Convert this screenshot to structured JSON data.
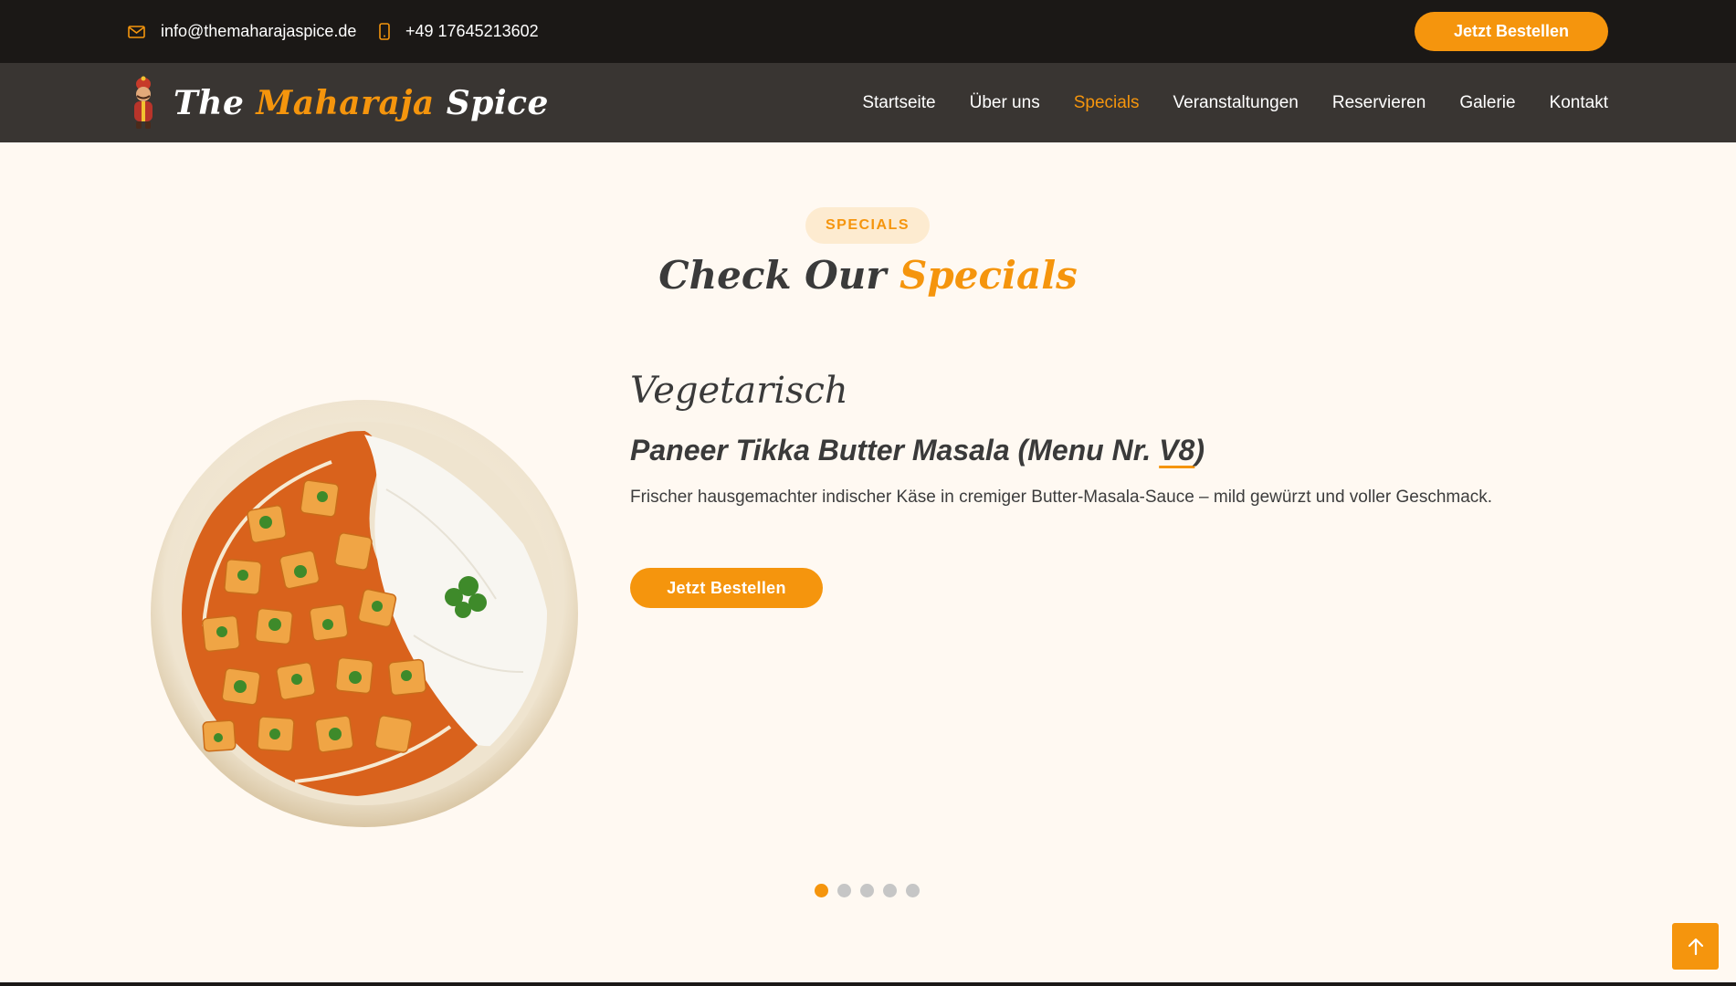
{
  "topbar": {
    "email": "info@themaharajaspice.de",
    "phone": "+49 17645213602",
    "order_label": "Jetzt Bestellen"
  },
  "logo": {
    "part1": "The ",
    "part2": "Maharaja",
    "part3": " Spice"
  },
  "nav": {
    "items": [
      {
        "label": "Startseite"
      },
      {
        "label": "Über uns"
      },
      {
        "label": "Specials"
      },
      {
        "label": "Veranstaltungen"
      },
      {
        "label": "Reservieren"
      },
      {
        "label": "Galerie"
      },
      {
        "label": "Kontakt"
      }
    ],
    "active": "Specials"
  },
  "section": {
    "badge": "SPECIALS",
    "title_part1": "Check Our ",
    "title_part2": "Specials"
  },
  "special": {
    "category": "Vegetarisch",
    "title_prefix": "Paneer Tikka Butter Masala (Menu Nr. ",
    "title_code": "V8",
    "title_suffix": ")",
    "description": "Frischer hausgemachter indischer Käse in cremiger Butter-Masala-Sauce – mild gewürzt und voller Geschmack.",
    "order_label": "Jetzt Bestellen"
  },
  "carousel": {
    "slides": 5,
    "active_index": 0
  },
  "colors": {
    "accent": "#f5950d",
    "topbar_bg": "#1b1816",
    "nav_bg": "#393532",
    "page_bg": "#fff9f2"
  },
  "icons": {
    "email": "envelope-icon",
    "phone": "mobile-phone-icon",
    "to_top": "arrow-up-icon"
  }
}
